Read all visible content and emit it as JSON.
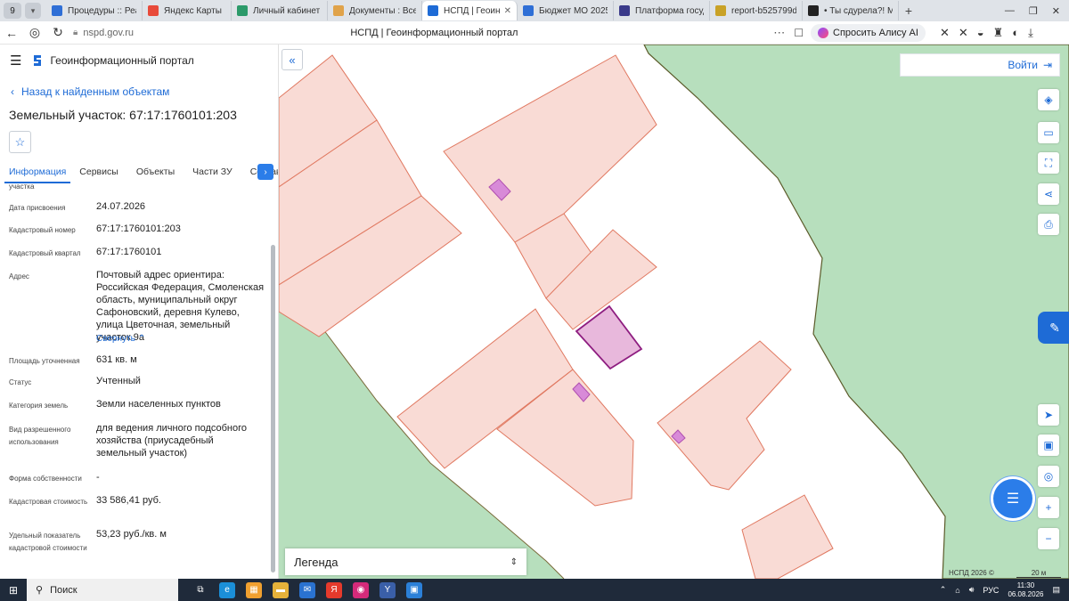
{
  "browser": {
    "tab_count": "9",
    "tabs": [
      {
        "title": "Процедуры :: Реализ",
        "color": "#2f6fd6"
      },
      {
        "title": "Яндекс Карты",
        "color": "#e84a3a"
      },
      {
        "title": "Личный кабинет",
        "color": "#2c9a6a"
      },
      {
        "title": "Документы : Все док",
        "color": "#e0a34a"
      },
      {
        "title": "НСПД | Геоинформ",
        "color": "#1e6bd6",
        "active": true
      },
      {
        "title": "Бюджет МО 2025г 24",
        "color": "#2f6fd6"
      },
      {
        "title": "Платформа государс",
        "color": "#3a3a8a"
      },
      {
        "title": "report-b525799d-bf5",
        "color": "#c9a227"
      },
      {
        "title": "• Ты сдурела?! Мне н",
        "color": "#222222"
      }
    ],
    "url": "nspd.gov.ru",
    "page_title": "НСПД | Геоинформационный портал",
    "alice": "Спросить Алису AI"
  },
  "app": {
    "name": "Геоинформационный портал",
    "back": "Назад к найденным объектам",
    "object_title": "Земельный участок: 67:17:1760101:203",
    "tabs": [
      "Информация",
      "Сервисы",
      "Объекты",
      "Части ЗУ",
      "Состав"
    ],
    "props_cutoff": "участка",
    "props": [
      {
        "k": "Дата присвоения",
        "v": "24.07.2026"
      },
      {
        "k": "Кадастровый номер",
        "v": "67:17:1760101:203"
      },
      {
        "k": "Кадастровый квартал",
        "v": "67:17:1760101"
      },
      {
        "k": "Адрес",
        "v": "Почтовый адрес ориентира: Российская Федерация, Смоленская область, муниципальный округ Сафоновский, деревня Кулево, улица Цветочная, земельный участок 9а"
      },
      {
        "k": "Площадь уточненная",
        "v": "631 кв. м"
      },
      {
        "k": "Статус",
        "v": "Учтенный"
      },
      {
        "k": "Категория земель",
        "v": "Земли населенных пунктов"
      },
      {
        "k": "Вид разрешенного использования",
        "v": "для ведения личного подсобного хозяйства (приусадебный земельный участок)"
      },
      {
        "k": "Форма собственности",
        "v": "-"
      },
      {
        "k": "Кадастровая стоимость",
        "v": "33 586,41 руб."
      },
      {
        "k": "Удельный показатель кадастровой стоимости",
        "v": "53,23 руб./кв. м"
      }
    ],
    "collapse": "Свернуть"
  },
  "map": {
    "login": "Войти",
    "legend": "Легенда",
    "copyright": "НСПД 2026 ©",
    "scale": "20 м"
  },
  "taskbar": {
    "search": "Поиск",
    "lang": "РУС",
    "time": "11:30",
    "date": "06.08.2026"
  }
}
